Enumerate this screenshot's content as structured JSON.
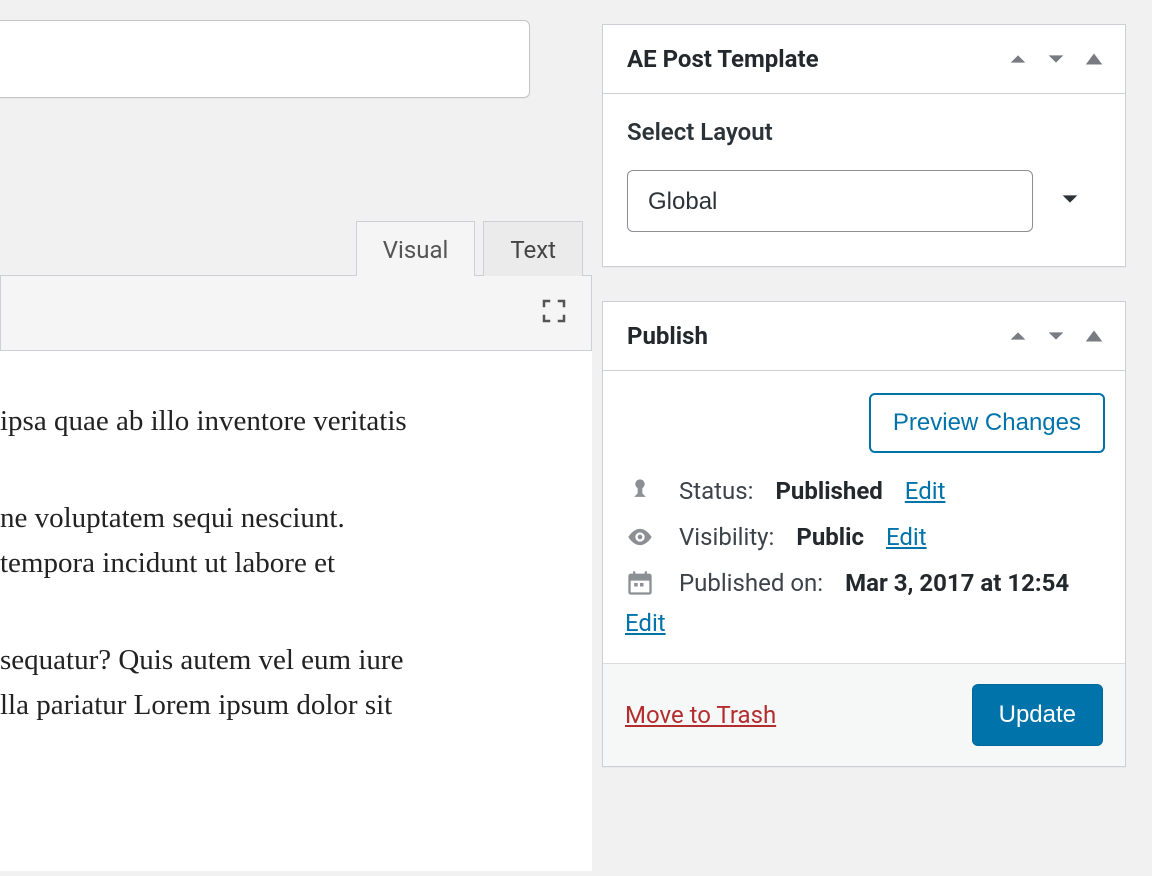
{
  "editor": {
    "title_value": "",
    "tabs": {
      "visual": "Visual",
      "text": "Text",
      "active": "visual"
    },
    "content": {
      "p1": "ipsa quae ab illo inventore veritatis",
      "p2": "ne voluptatem sequi nesciunt. tempora incidunt ut labore et",
      "p3": "sequatur? Quis autem vel eum iure lla pariatur Lorem ipsum dolor sit"
    }
  },
  "panels": {
    "ae_post_template": {
      "title": "AE Post Template",
      "field_label": "Select Layout",
      "select_value": "Global"
    },
    "publish": {
      "title": "Publish",
      "preview_button": "Preview Changes",
      "status": {
        "label": "Status:",
        "value": "Published",
        "edit": "Edit"
      },
      "visibility": {
        "label": "Visibility:",
        "value": "Public",
        "edit": "Edit"
      },
      "published_on": {
        "label": "Published on:",
        "value": "Mar 3, 2017 at 12:54",
        "edit": "Edit"
      },
      "trash": "Move to Trash",
      "update": "Update"
    }
  }
}
